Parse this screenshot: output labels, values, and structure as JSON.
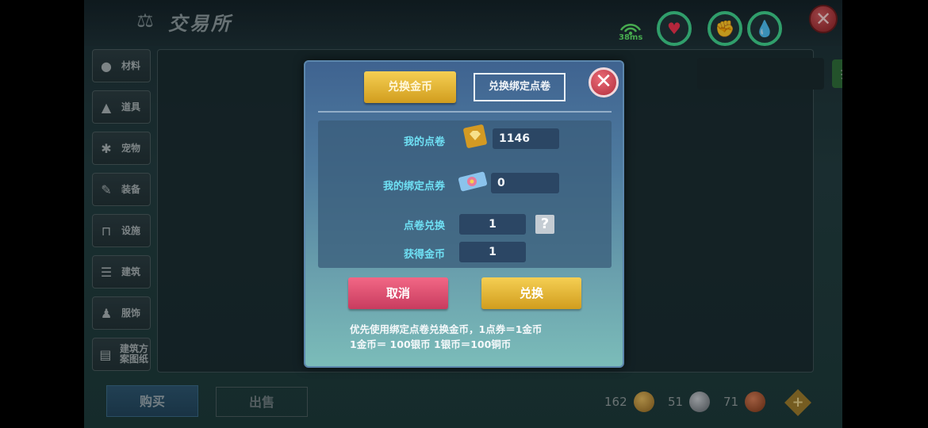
{
  "header": {
    "title": "交易所",
    "ping": "38ms"
  },
  "sidebar": {
    "items": [
      {
        "label": "材料",
        "icon": "materials-icon"
      },
      {
        "label": "道具",
        "icon": "props-icon"
      },
      {
        "label": "宠物",
        "icon": "pet-paw-icon"
      },
      {
        "label": "装备",
        "icon": "equipment-icon"
      },
      {
        "label": "设施",
        "icon": "facility-icon"
      },
      {
        "label": "建筑",
        "icon": "building-icon"
      },
      {
        "label": "服饰",
        "icon": "clothing-icon"
      },
      {
        "label": "建筑方案图纸",
        "icon": "blueprint-icon"
      }
    ]
  },
  "search": {
    "button_label": "搜索",
    "value": ""
  },
  "bottom": {
    "buy_label": "购买",
    "sell_label": "出售",
    "gold": "162",
    "silver": "51",
    "copper": "71"
  },
  "modal": {
    "tab_gold": "兑换金币",
    "tab_bound": "兑换绑定点卷",
    "my_points_label": "我的点卷",
    "my_points_value": "1146",
    "my_bound_label": "我的绑定点券",
    "my_bound_value": "0",
    "exchange_label": "点卷兑换",
    "exchange_value": "1",
    "gain_label": "获得金币",
    "gain_value": "1",
    "cancel_label": "取消",
    "confirm_label": "兑换",
    "note_line1": "优先使用绑定点卷兑换金币，1点券＝1金币",
    "note_line2": "1金币＝ 100银币 1银币＝100铜币"
  },
  "colors": {
    "accent_gold": "#e4b434",
    "cancel_pink": "#e0506f",
    "label_cyan": "#6fe0f4",
    "status_green": "#41d38f"
  }
}
